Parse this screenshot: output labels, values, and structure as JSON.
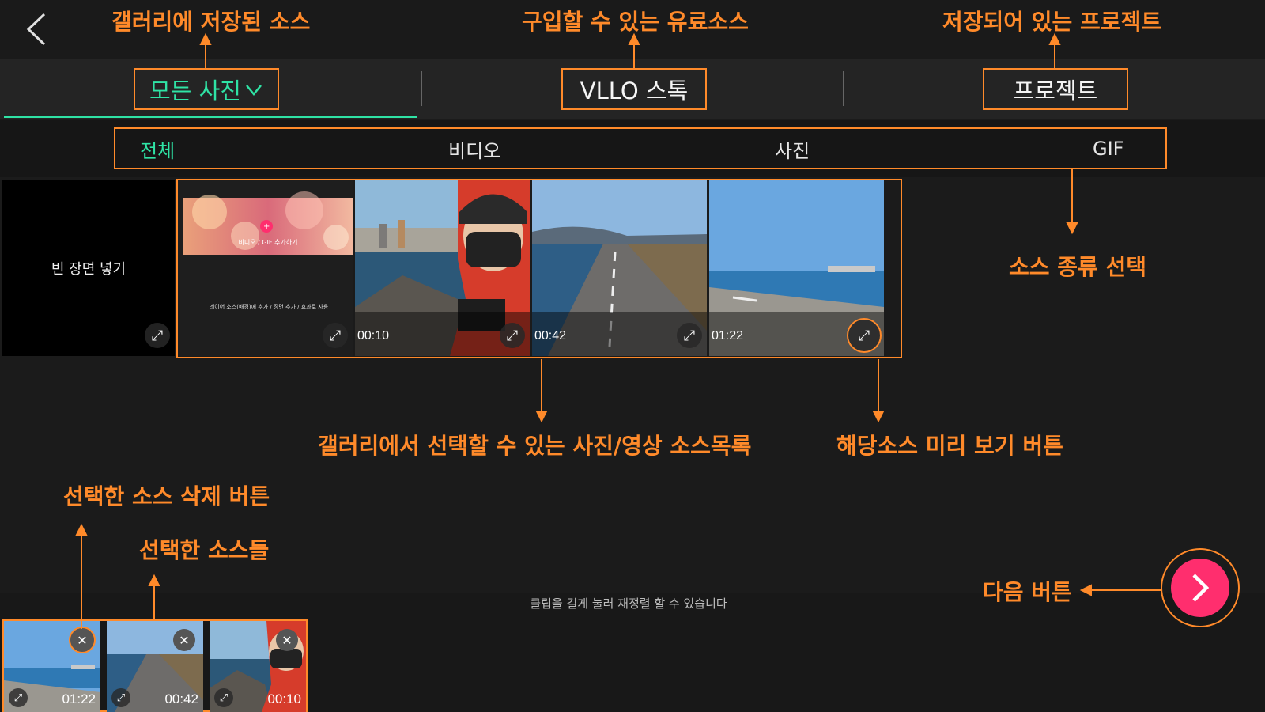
{
  "tabs": {
    "all_photos": "모든 사진",
    "vllo_stock": "VLLO 스톡",
    "project": "프로젝트"
  },
  "filters": [
    "전체",
    "비디오",
    "사진",
    "GIF"
  ],
  "gallery": {
    "blank_label": "빈 장면 넣기",
    "items": [
      {
        "type": "promo",
        "line1": "비디오 / GIF 추가하기",
        "line2": "레이어 소스(배경)에 추가 / 장면 추가 / 효과로 사용"
      },
      {
        "type": "video",
        "duration": "00:10"
      },
      {
        "type": "video",
        "duration": "00:42"
      },
      {
        "type": "video",
        "duration": "01:22"
      }
    ]
  },
  "selected": [
    {
      "duration": "01:22"
    },
    {
      "duration": "00:42"
    },
    {
      "duration": "00:10"
    }
  ],
  "reorder_hint": "클립을 길게 눌러 재정렬 할 수 있습니다",
  "annotations": {
    "gallery_saved": "갤러리에 저장된 소스",
    "paid_source": "구입할 수 있는 유료소스",
    "saved_project": "저장되어 있는 프로젝트",
    "source_type": "소스 종류 선택",
    "gallery_list": "갤러리에서 선택할 수 있는 사진/영상 소스목록",
    "preview_button": "해당소스 미리 보기 버튼",
    "delete_button": "선택한 소스 삭제 버튼",
    "selected_sources": "선택한 소스들",
    "next_button": "다음 버튼"
  },
  "colors": {
    "accent_green": "#2fe3a5",
    "annotation_orange": "#ff8a2a",
    "next_pink": "#ff2e6e"
  },
  "icons": {
    "back": "chevron-left-icon",
    "dropdown": "chevron-down-icon",
    "expand": "expand-icon",
    "remove": "close-icon",
    "next": "chevron-right-icon"
  }
}
